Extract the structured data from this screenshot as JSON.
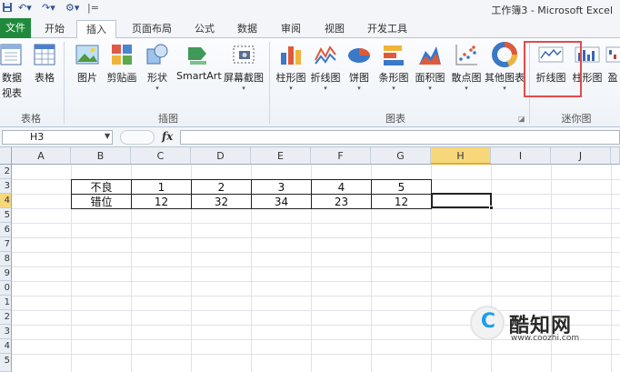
{
  "title_bar": {
    "app_title": "工作簿3 - Microsoft Excel",
    "qa_customize": "|="
  },
  "tabs": [
    {
      "id": "file",
      "label": "文件"
    },
    {
      "id": "home",
      "label": "开始"
    },
    {
      "id": "insert",
      "label": "插入",
      "active": true
    },
    {
      "id": "page_layout",
      "label": "页面布局"
    },
    {
      "id": "formulas",
      "label": "公式"
    },
    {
      "id": "data",
      "label": "数据"
    },
    {
      "id": "review",
      "label": "审阅"
    },
    {
      "id": "view",
      "label": "视图"
    },
    {
      "id": "developer",
      "label": "开发工具"
    }
  ],
  "ribbon": {
    "tables": {
      "group_label": "表格",
      "pivot_line1": "数据",
      "pivot_line2": "视表",
      "table": "表格"
    },
    "illustrations": {
      "group_label": "插图",
      "picture": "图片",
      "clipart": "剪贴画",
      "shapes": "形状",
      "smartart": "SmartArt",
      "screenshot": "屏幕截图"
    },
    "charts": {
      "group_label": "图表",
      "column": "柱形图",
      "line": "折线图",
      "pie": "饼图",
      "bar": "条形图",
      "area": "面积图",
      "scatter": "散点图",
      "other": "其他图表"
    },
    "sparklines": {
      "group_label": "迷你图",
      "line": "折线图",
      "column": "柱形图",
      "winloss": "盈"
    }
  },
  "formula_bar": {
    "name_box": "H3",
    "fx": "fx",
    "value": ""
  },
  "columns": [
    "A",
    "B",
    "C",
    "D",
    "E",
    "F",
    "G",
    "H",
    "I",
    "J"
  ],
  "active_column": "H",
  "row_numbers": [
    "2",
    "3",
    "4",
    "5",
    "6",
    "7",
    "8",
    "9",
    "0",
    "1",
    "2",
    "3",
    "4",
    "5"
  ],
  "table": {
    "rows": [
      [
        "不良",
        "1",
        "2",
        "3",
        "4",
        "5"
      ],
      [
        "错位",
        "12",
        "32",
        "34",
        "23",
        "12"
      ]
    ]
  },
  "watermark": {
    "logo_letter": "C",
    "text": "酷知网",
    "url": "www.coozhi.com"
  },
  "colors": {
    "file_tab": "#1f8a3c",
    "highlight": "#e14b4b",
    "active_header": "#f6d87a"
  }
}
